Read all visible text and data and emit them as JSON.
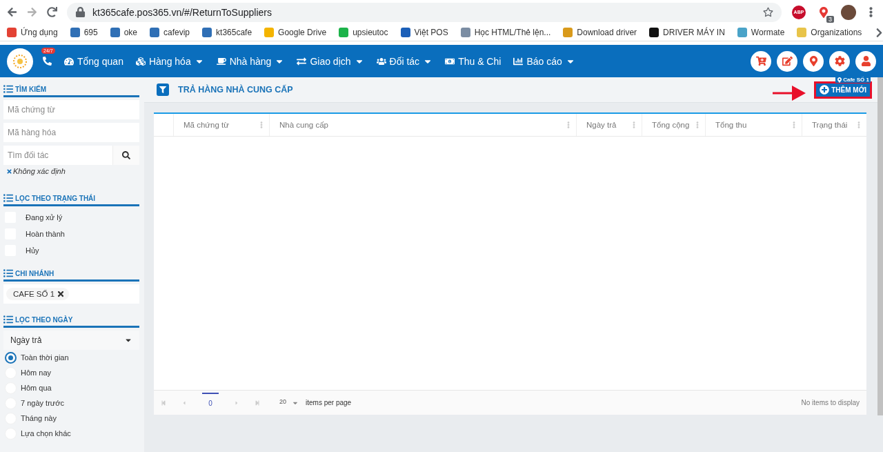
{
  "browser": {
    "url": "kt365cafe.pos365.vn/#/ReturnToSuppliers",
    "extension_badge": "3",
    "adblock_label": "ABP",
    "bookmarks": [
      {
        "label": "Ứng dụng",
        "color": "#e34234"
      },
      {
        "label": "695",
        "color": "#2f6fb5"
      },
      {
        "label": "oke",
        "color": "#2f6fb5"
      },
      {
        "label": "cafevip",
        "color": "#2f6fb5"
      },
      {
        "label": "kt365cafe",
        "color": "#2f6fb5"
      },
      {
        "label": "Google Drive",
        "color": "#f4b400"
      },
      {
        "label": "upsieutoc",
        "color": "#1db34a"
      },
      {
        "label": "Việt POS",
        "color": "#1b5fb8"
      },
      {
        "label": "Học HTML/Thẻ lện...",
        "color": "#7b8da3"
      },
      {
        "label": "Download driver",
        "color": "#d99a1b"
      },
      {
        "label": "DRIVER MÁY IN",
        "color": "#111111"
      },
      {
        "label": "Wormate",
        "color": "#4aa3c8"
      },
      {
        "label": "Organizations",
        "color": "#e8c44a"
      }
    ]
  },
  "nav": {
    "badge": "24/7",
    "location": "Cafe SỐ 1",
    "items": [
      {
        "label": "Tổng quan",
        "dropdown": false
      },
      {
        "label": "Hàng hóa",
        "dropdown": true
      },
      {
        "label": "Nhà hàng",
        "dropdown": true
      },
      {
        "label": "Giao dịch",
        "dropdown": true
      },
      {
        "label": "Đối tác",
        "dropdown": true
      },
      {
        "label": "Thu & Chi",
        "dropdown": false
      },
      {
        "label": "Báo cáo",
        "dropdown": true
      }
    ]
  },
  "sidebar": {
    "search": {
      "title": "TÌM KIẾM",
      "fields": [
        {
          "placeholder": "Mã chứng từ"
        },
        {
          "placeholder": "Mã hàng hóa"
        }
      ],
      "partner_field": {
        "placeholder": "Tìm đối tác"
      },
      "partner_tag": "Không xác định"
    },
    "status": {
      "title": "LỌC THEO TRẠNG THÁI",
      "options": [
        {
          "label": "Đang xử lý",
          "checked": false
        },
        {
          "label": "Hoàn thành",
          "checked": false
        },
        {
          "label": "Hủy",
          "checked": false
        }
      ]
    },
    "branch": {
      "title": "CHI NHÁNH",
      "tags": [
        "CAFE SỐ 1"
      ]
    },
    "date": {
      "title": "LỌC THEO NGÀY",
      "select": "Ngày trả",
      "options": [
        {
          "label": "Toàn thời gian",
          "selected": true
        },
        {
          "label": "Hôm nay",
          "selected": false
        },
        {
          "label": "Hôm qua",
          "selected": false
        },
        {
          "label": "7 ngày trước",
          "selected": false
        },
        {
          "label": "Tháng này",
          "selected": false
        },
        {
          "label": "Lựa chọn khác",
          "selected": false
        }
      ]
    }
  },
  "page": {
    "title": "TRẢ HÀNG NHÀ CUNG CẤP",
    "add_button": {
      "label": "THÊM MỚI",
      "highlighted": true
    },
    "table": {
      "columns": [
        "Mã chứng từ",
        "Nhà cung cấp",
        "Ngày trả",
        "Tổng cộng",
        "Tổng thu",
        "Trạng thái"
      ]
    },
    "pagination": {
      "page": "0",
      "page_size": "20",
      "page_size_label": "items per page",
      "status": "No items to display"
    }
  }
}
